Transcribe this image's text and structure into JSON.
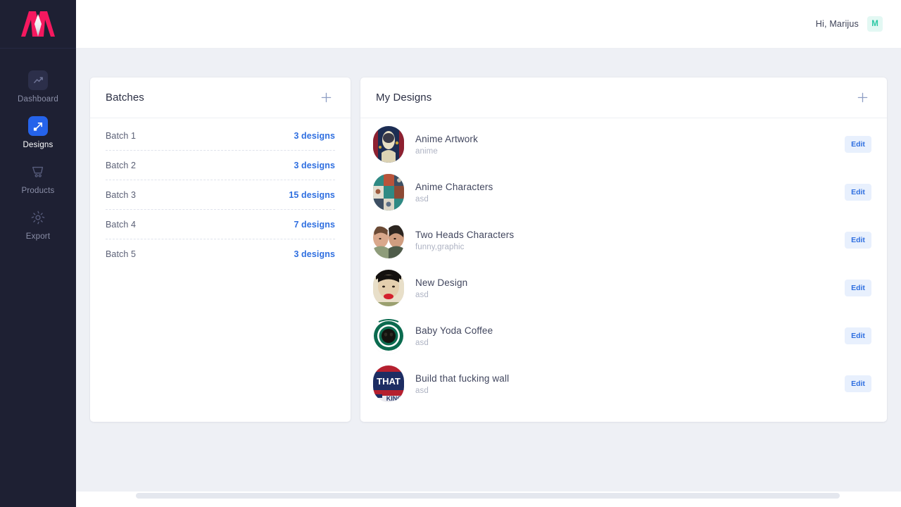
{
  "sidebar": {
    "logo_alt": "Marijus logo",
    "items": [
      {
        "label": "Dashboard",
        "icon": "chart-trend-icon",
        "active": false
      },
      {
        "label": "Designs",
        "icon": "design-arrow-icon",
        "active": true
      },
      {
        "label": "Products",
        "icon": "shopping-cart-icon",
        "active": false
      },
      {
        "label": "Export",
        "icon": "gear-icon",
        "active": false
      }
    ]
  },
  "topbar": {
    "greeting": "Hi,  Marijus",
    "avatar_initial": "M",
    "avatar_bg": "#e3f8f3",
    "avatar_color": "#2bc8a4"
  },
  "batches": {
    "title": "Batches",
    "add_icon": "plus-icon",
    "rows": [
      {
        "name": "Batch 1",
        "count": "3 designs"
      },
      {
        "name": "Batch 2",
        "count": "3 designs"
      },
      {
        "name": "Batch 3",
        "count": "15 designs"
      },
      {
        "name": "Batch 4",
        "count": "7 designs"
      },
      {
        "name": "Batch 5",
        "count": "3 designs"
      }
    ]
  },
  "designs": {
    "title": "My Designs",
    "add_icon": "plus-icon",
    "edit_label": "Edit",
    "rows": [
      {
        "title": "Anime Artwork",
        "sub": "anime",
        "thumb": "anime-artwork-thumb"
      },
      {
        "title": "Anime Characters",
        "sub": "asd",
        "thumb": "anime-characters-thumb"
      },
      {
        "title": "Two Heads Characters",
        "sub": "funny,graphic",
        "thumb": "two-heads-thumb"
      },
      {
        "title": "New Design",
        "sub": "asd",
        "thumb": "new-design-thumb"
      },
      {
        "title": "Baby Yoda Coffee",
        "sub": "asd",
        "thumb": "baby-yoda-thumb"
      },
      {
        "title": "Build that fucking wall",
        "sub": "asd",
        "thumb": "build-wall-thumb"
      }
    ]
  },
  "colors": {
    "accent_blue": "#2f6fe0",
    "sidebar_bg": "#1e2033",
    "page_bg": "#eef0f5",
    "logo_pink": "#f5185f"
  }
}
